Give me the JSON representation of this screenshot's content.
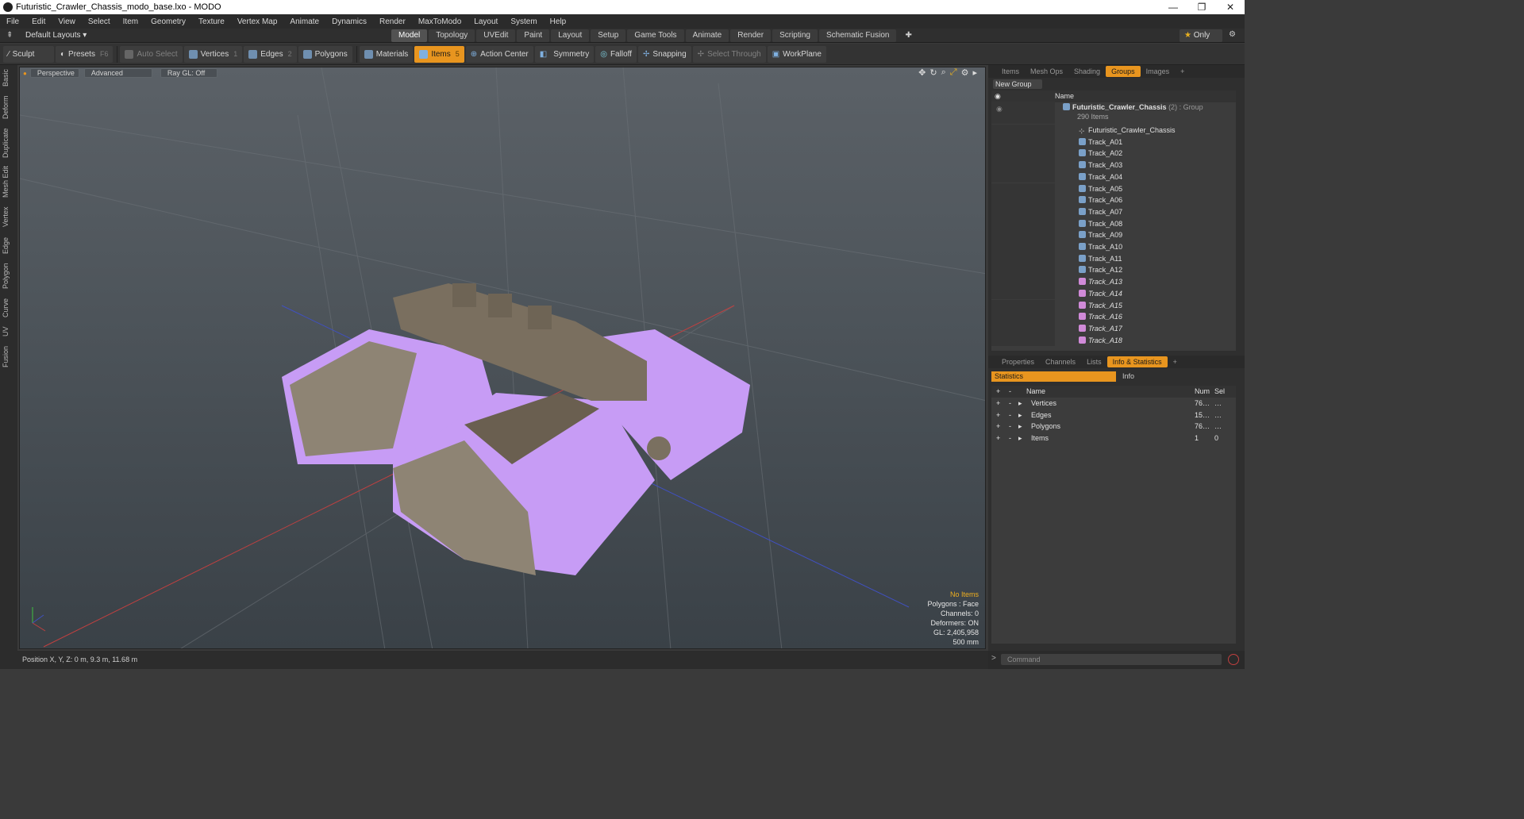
{
  "window": {
    "title": "Futuristic_Crawler_Chassis_modo_base.lxo - MODO",
    "buttons": [
      "—",
      "❐",
      "✕"
    ]
  },
  "menu": [
    "File",
    "Edit",
    "View",
    "Select",
    "Item",
    "Geometry",
    "Texture",
    "Vertex Map",
    "Animate",
    "Dynamics",
    "Render",
    "MaxToModo",
    "Layout",
    "System",
    "Help"
  ],
  "layoutbar": {
    "layouts_label": "Default Layouts",
    "tabs": [
      "Model",
      "Topology",
      "UVEdit",
      "Paint",
      "Layout",
      "Setup",
      "Game Tools",
      "Animate",
      "Render",
      "Scripting",
      "Schematic Fusion"
    ],
    "active_tab": "Model",
    "only_label": "Only"
  },
  "toolbar": {
    "sculpt": "Sculpt",
    "presets": "Presets",
    "presets_key": "F6",
    "auto_select": "Auto Select",
    "vertices": "Vertices",
    "vertices_key": "1",
    "edges": "Edges",
    "edges_key": "2",
    "polygons": "Polygons",
    "materials": "Materials",
    "items": "Items",
    "items_key": "5",
    "action_center": "Action Center",
    "symmetry": "Symmetry",
    "falloff": "Falloff",
    "snapping": "Snapping",
    "select_through": "Select Through",
    "workplane": "WorkPlane"
  },
  "left_tabs": [
    "Basic",
    "Deform",
    "Duplicate",
    "Mesh Edit",
    "Vertex",
    "Edge",
    "Polygon",
    "Curve",
    "UV",
    "Fusion"
  ],
  "viewport": {
    "perspective": "Perspective",
    "advanced": "Advanced",
    "raygl": "Ray GL: Off",
    "info": {
      "no_items": "No Items",
      "polygons": "Polygons : Face",
      "channels": "Channels: 0",
      "deformers": "Deformers: ON",
      "gl": "GL: 2,405,958",
      "scale": "500 mm"
    }
  },
  "status": {
    "position": "Position X, Y, Z:  0 m, 9.3 m, 11.68 m"
  },
  "groups_panel": {
    "tabs": [
      "Items",
      "Mesh Ops",
      "Shading",
      "Groups",
      "Images"
    ],
    "active_tab": "Groups",
    "new_group": "New Group",
    "name_col": "Name",
    "group_name": "Futuristic_Crawler_Chassis",
    "group_suffix": "(2) : Group",
    "group_count": "290 Items",
    "items": [
      {
        "name": "Futuristic_Crawler_Chassis",
        "kind": "locator"
      },
      {
        "name": "Track_A01",
        "kind": "mesh"
      },
      {
        "name": "Track_A02",
        "kind": "mesh"
      },
      {
        "name": "Track_A03",
        "kind": "mesh"
      },
      {
        "name": "Track_A04",
        "kind": "mesh"
      },
      {
        "name": "Track_A05",
        "kind": "mesh"
      },
      {
        "name": "Track_A06",
        "kind": "mesh"
      },
      {
        "name": "Track_A07",
        "kind": "mesh"
      },
      {
        "name": "Track_A08",
        "kind": "mesh"
      },
      {
        "name": "Track_A09",
        "kind": "mesh"
      },
      {
        "name": "Track_A10",
        "kind": "mesh"
      },
      {
        "name": "Track_A11",
        "kind": "mesh"
      },
      {
        "name": "Track_A12",
        "kind": "mesh"
      },
      {
        "name": "Track_A13",
        "kind": "instance"
      },
      {
        "name": "Track_A14",
        "kind": "instance"
      },
      {
        "name": "Track_A15",
        "kind": "instance"
      },
      {
        "name": "Track_A16",
        "kind": "instance"
      },
      {
        "name": "Track_A17",
        "kind": "instance"
      },
      {
        "name": "Track_A18",
        "kind": "instance"
      }
    ]
  },
  "stats_panel": {
    "tabs": [
      "Properties",
      "Channels",
      "Lists",
      "Info & Statistics"
    ],
    "active_tab": "Info & Statistics",
    "subtabs": [
      "Statistics",
      "Info"
    ],
    "columns": [
      "Name",
      "Num",
      "Sel"
    ],
    "rows": [
      {
        "name": "Vertices",
        "num": "76…",
        "sel": "…"
      },
      {
        "name": "Edges",
        "num": "15…",
        "sel": "…"
      },
      {
        "name": "Polygons",
        "num": "76…",
        "sel": "…"
      },
      {
        "name": "Items",
        "num": "1",
        "sel": "0"
      }
    ]
  },
  "command": {
    "placeholder": "Command"
  },
  "colors": {
    "accent": "#e8951f",
    "selection_purple": "#c79cf5",
    "viewport_top": "#5b6167",
    "viewport_bottom": "#3a4147"
  }
}
